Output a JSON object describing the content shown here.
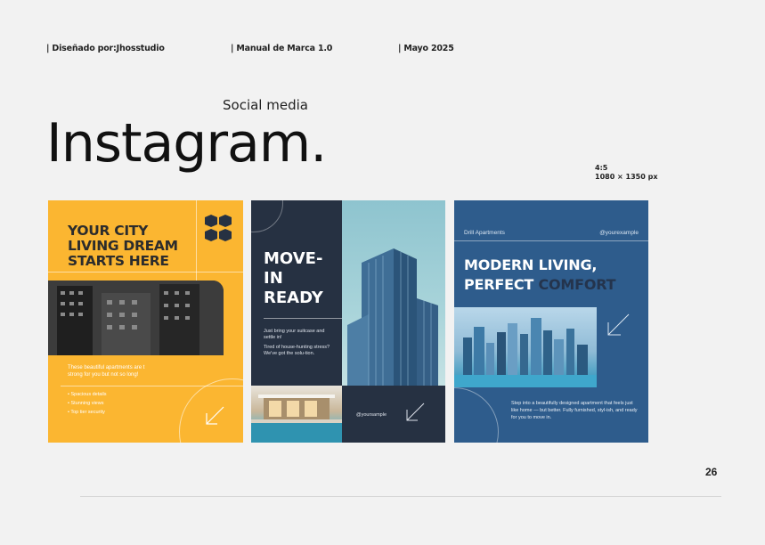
{
  "header": {
    "designed_by": "| Diseñado por:Jhosstudio",
    "manual": "| Manual de Marca 1.0",
    "date": "| Mayo 2025"
  },
  "section_label": "Social media",
  "page_title": "Instagram.",
  "format": {
    "ratio": "4:5",
    "size": "1080 × 1350 px"
  },
  "posts": [
    {
      "background": "#fbb631",
      "headline": [
        "YOUR CITY",
        "LIVING DREAM",
        "STARTS HERE"
      ],
      "body": [
        "These beautiful apartments are t",
        "strong for you but not so long!"
      ],
      "list": [
        "Spacious details",
        "Stunning views",
        "Top tier security"
      ]
    },
    {
      "background": "#263142",
      "headline": [
        "MOVE-",
        "IN",
        "READY"
      ],
      "sub": "Just bring your suitcase and settle in!",
      "sub2": "Tired of house-hunting stress? We've got the solu-tion.",
      "handle": "@yoursample"
    },
    {
      "background": "#2e5c8c",
      "brand": "Drill Apartments",
      "handle": "@yourexample",
      "headline_line1": "MODERN LIVING,",
      "headline_line2_white": "PERFECT",
      "headline_line2_accent": "COMFORT",
      "body": "Step into a beautifully designed apartment that feels just like home — but better. Fully furnished, styl-ish, and ready for you to move in."
    }
  ],
  "page_number": "26"
}
